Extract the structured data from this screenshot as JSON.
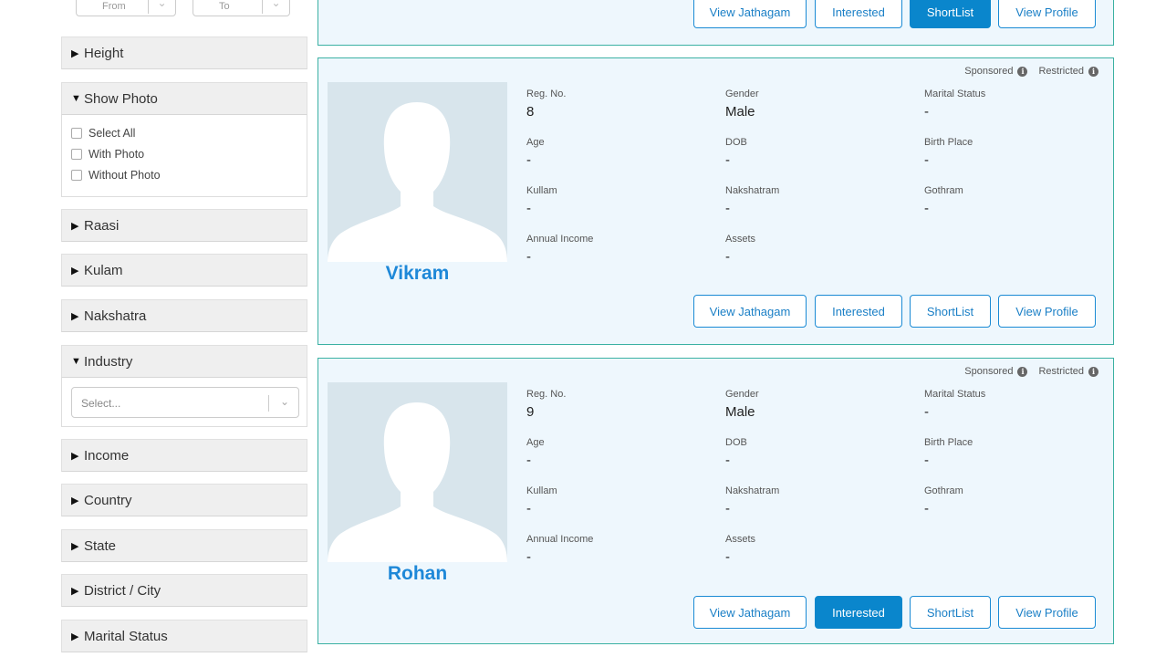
{
  "filters": {
    "range": {
      "from_placeholder": "From",
      "to_placeholder": "To"
    },
    "height_label": "Height",
    "show_photo": {
      "label": "Show Photo",
      "options": [
        "Select All",
        "With Photo",
        "Without Photo"
      ]
    },
    "raasi_label": "Raasi",
    "kulam_label": "Kulam",
    "nakshatra_label": "Nakshatra",
    "industry": {
      "label": "Industry",
      "placeholder": "Select..."
    },
    "income_label": "Income",
    "country_label": "Country",
    "state_label": "State",
    "district_label": "District / City",
    "marital_label": "Marital Status"
  },
  "labels": {
    "sponsored": "Sponsored",
    "restricted": "Restricted",
    "reg_no": "Reg. No.",
    "gender": "Gender",
    "marital_status": "Marital Status",
    "age": "Age",
    "dob": "DOB",
    "birth_place": "Birth Place",
    "kullam": "Kullam",
    "nakshatram": "Nakshatram",
    "gothram": "Gothram",
    "annual_income": "Annual Income",
    "assets": "Assets"
  },
  "buttons": {
    "view_jathagam": "View Jathagam",
    "interested": "Interested",
    "shortlist": "ShortList",
    "view_profile": "View Profile"
  },
  "profiles": [
    {
      "name": "Vikram",
      "reg_no": "8",
      "gender": "Male",
      "marital_status": "-",
      "age": "-",
      "dob": "-",
      "birth_place": "-",
      "kullam": "-",
      "nakshatram": "-",
      "gothram": "-",
      "annual_income": "-",
      "assets": "-"
    },
    {
      "name": "Rohan",
      "reg_no": "9",
      "gender": "Male",
      "marital_status": "-",
      "age": "-",
      "dob": "-",
      "birth_place": "-",
      "kullam": "-",
      "nakshatram": "-",
      "gothram": "-",
      "annual_income": "-",
      "assets": "-"
    }
  ],
  "colors": {
    "accent": "#0a86cc",
    "card_bg": "#eef7fd",
    "card_border": "#3bb1a3",
    "name": "#1e88d8"
  }
}
